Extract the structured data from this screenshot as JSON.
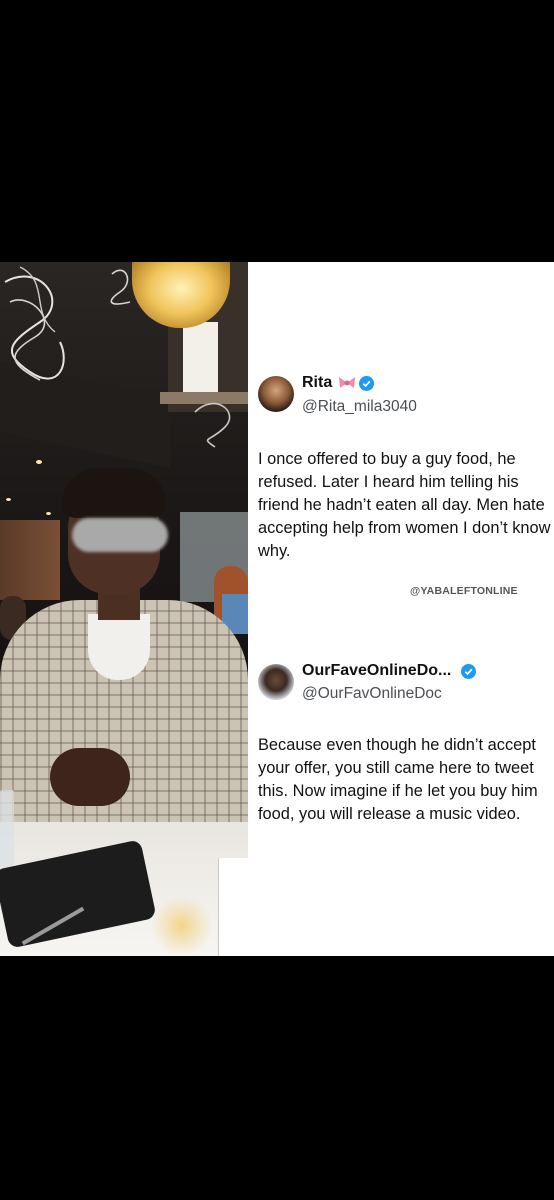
{
  "tweet1": {
    "name": "Rita",
    "handle": "@Rita_mila3040",
    "text": "I once offered to buy a guy food, he refused. Later I heard him telling his friend he hadn’t eaten all day.  Men hate accepting help from women I don’t know why."
  },
  "watermark": "@YABALEFTONLINE",
  "tweet2": {
    "name": "OurFaveOnlineDo...",
    "handle": "@OurFavOnlineDoc",
    "text": "Because even though he didn’t accept your offer, you still came here to tweet this. Now imagine if he let you buy him food, you will release a music video."
  },
  "icons": {
    "verified": "verified-badge-icon",
    "bow": "pink-bow-emoji-icon"
  },
  "colors": {
    "verified_blue": "#1d9bf0",
    "bow_pink": "#f08aa8",
    "background": "#000000"
  }
}
